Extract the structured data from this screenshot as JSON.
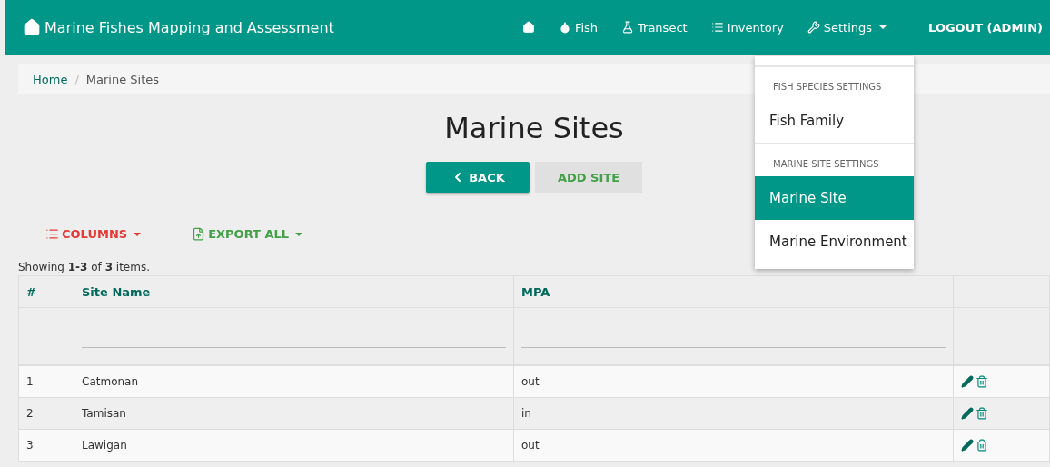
{
  "navbar": {
    "brand": "Marine Fishes Mapping and Assessment",
    "items": [
      {
        "kind": "home"
      },
      {
        "kind": "fish",
        "label": "Fish"
      },
      {
        "kind": "transect",
        "label": "Transect"
      },
      {
        "kind": "inventory",
        "label": "Inventory"
      },
      {
        "kind": "settings",
        "label": "Settings",
        "expanded": true
      }
    ],
    "logout": "LOGOUT (ADMIN)"
  },
  "settings_menu": [
    {
      "header": "FISH SPECIES SETTINGS",
      "items": [
        {
          "label": "Fish Family",
          "selected": false
        }
      ]
    },
    {
      "header": "MARINE SITE SETTINGS",
      "items": [
        {
          "label": "Marine Site",
          "selected": true
        },
        {
          "label": "Marine Environment",
          "selected": false
        }
      ]
    }
  ],
  "breadcrumb": [
    "Home",
    "Marine Sites"
  ],
  "breadcrumb_separator": "/",
  "title": "Marine Sites",
  "buttons": {
    "back": "BACK",
    "add": "ADD SITE"
  },
  "toolbar": {
    "columns": "COLUMNS",
    "export": "EXPORT ALL"
  },
  "summary": "Showing **1-3** of **3** items.",
  "table": {
    "columns": [
      "#",
      "Site Name",
      "MPA"
    ],
    "rows": [
      {
        "cells": [
          "1",
          "Catmonan",
          "out"
        ]
      },
      {
        "cells": [
          "2",
          "Tamisan",
          "in"
        ]
      },
      {
        "cells": [
          "3",
          "Lawigan",
          "out"
        ]
      }
    ]
  }
}
